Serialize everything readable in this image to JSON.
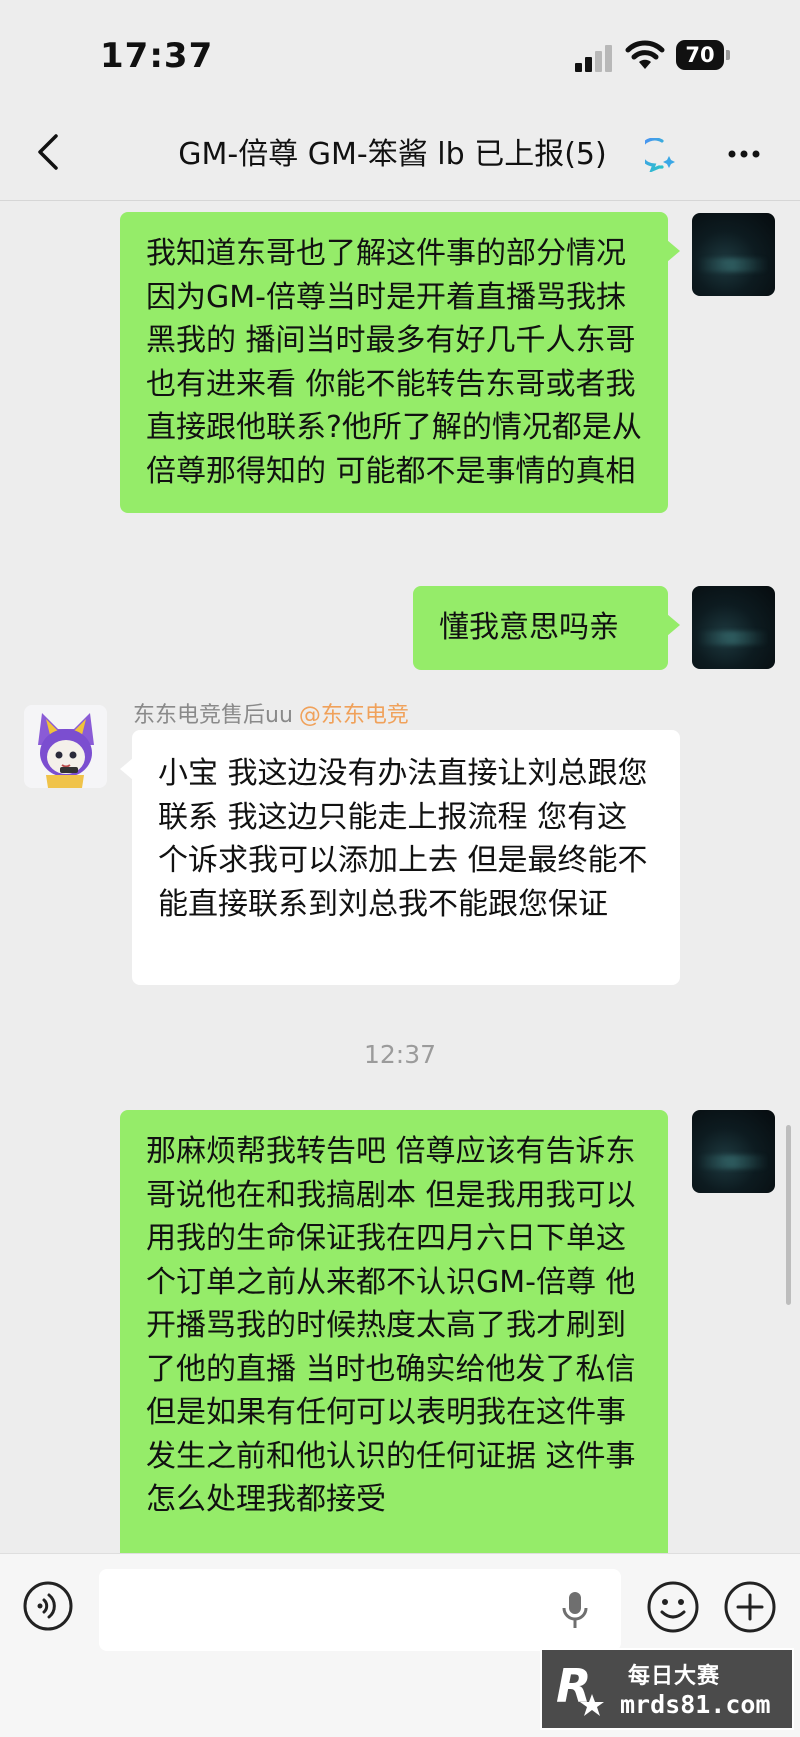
{
  "status_bar": {
    "time": "17:37",
    "battery": "70"
  },
  "nav": {
    "title": "GM-倍尊 GM-笨酱 lb 已上报(5)"
  },
  "messages": {
    "m1": "我知道东哥也了解这件事的部分情况 因为GM-倍尊当时是开着直播骂我抹黑我的 播间当时最多有好几千人东哥也有进来看 你能不能转告东哥或者我直接跟他联系?他所了解的情况都是从倍尊那得知的 可能都不是事情的真相",
    "m2": "懂我意思吗亲",
    "sender_name": "东东电竞售后uu",
    "sender_tag": "@东东电竞",
    "m3": "小宝 我这边没有办法直接让刘总跟您联系 我这边只能走上报流程 您有这个诉求我可以添加上去 但是最终能不能直接联系到刘总我不能跟您保证",
    "timestamp": "12:37",
    "m4": "那麻烦帮我转告吧 倍尊应该有告诉东哥说他在和我搞剧本 但是我用我可以用我的生命保证我在四月六日下单这个订单之前从来都不认识GM-倍尊 他开播骂我的时候热度太高了我才刷到了他的直播 当时也确实给他发了私信 但是如果有任何可以表明我在这件事发生之前和他认识的任何证据 这件事怎么处理我都接受"
  },
  "input": {
    "placeholder": ""
  },
  "watermark": {
    "title": "每日大赛",
    "site": "mrds81.com"
  },
  "colors": {
    "green_bubble": "#95ec69",
    "white_bubble": "#ffffff",
    "background": "#ededed",
    "sender_tag": "#f0a15a"
  },
  "icons": [
    "back-chevron-icon",
    "chat-ai-icon",
    "more-dots-icon",
    "voice-icon",
    "mic-icon",
    "emoji-icon",
    "plus-icon"
  ]
}
